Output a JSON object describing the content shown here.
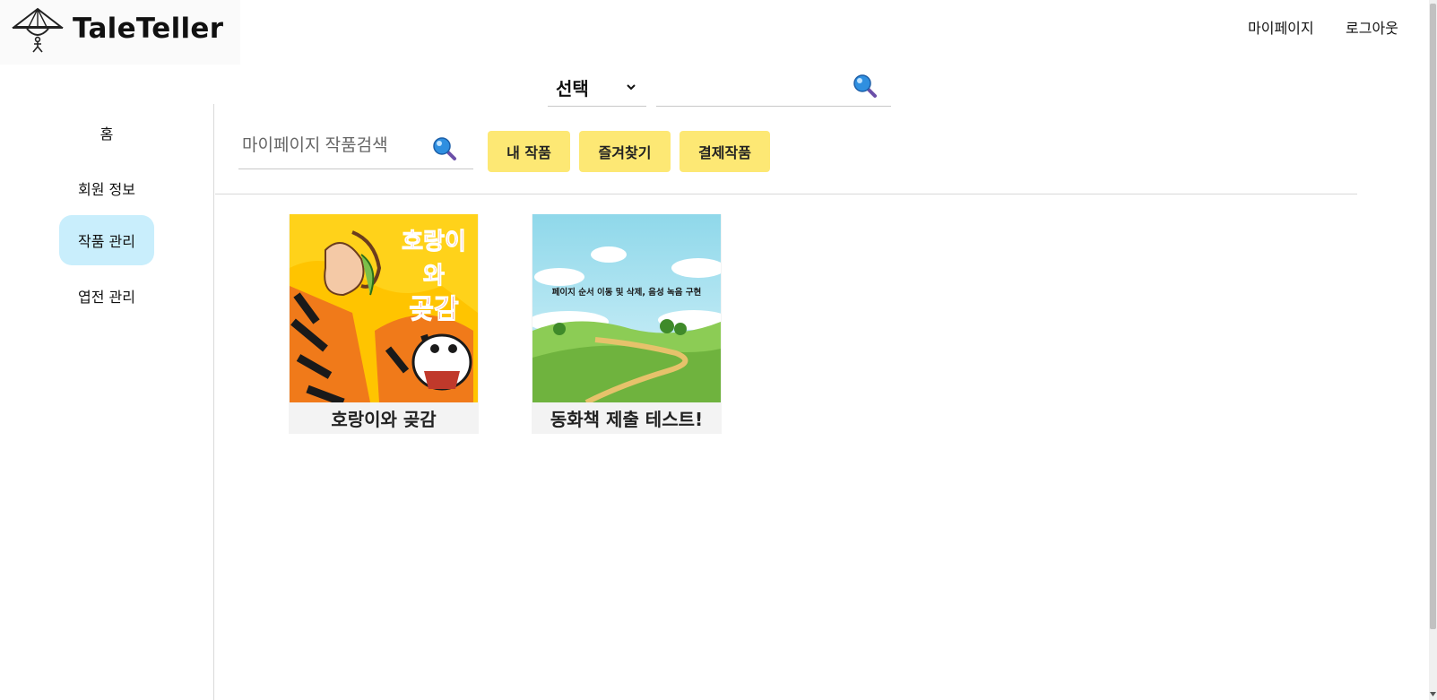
{
  "brand": {
    "name": "TaleTeller",
    "logo_icon": "straw-hat-child-icon"
  },
  "header": {
    "mypage_label": "마이페이지",
    "logout_label": "로그아웃"
  },
  "global_search": {
    "select_value": "선택",
    "input_value": "",
    "search_icon": "magnifier-icon"
  },
  "sidebar": {
    "items": [
      {
        "label": "홈",
        "active": false
      },
      {
        "label": "회원 정보",
        "active": false
      },
      {
        "label": "작품 관리",
        "active": true
      },
      {
        "label": "엽전 관리",
        "active": false
      }
    ]
  },
  "works": {
    "search_placeholder": "마이페이지 작품검색",
    "filters": [
      {
        "label": "내 작품"
      },
      {
        "label": "즐겨찾기"
      },
      {
        "label": "결제작품"
      }
    ],
    "cards": [
      {
        "title": "호랑이와 곶감",
        "cover": {
          "headline_line1": "호랑이와",
          "headline_line2": "곶감",
          "colors": {
            "background": "#ffd21a",
            "tiger": "#f07a1a"
          }
        }
      },
      {
        "title": "동화책 제출 테스트!",
        "cover": {
          "caption": "페이지 순서 이동 및 삭제, 음성 녹음 구현",
          "colors": {
            "sky": "#9fdff0",
            "grass": "#7fc24a"
          }
        }
      }
    ]
  },
  "colors": {
    "accent_yellow": "#fde874",
    "active_nav": "#c9eefc",
    "divider": "#d9d9d9"
  }
}
